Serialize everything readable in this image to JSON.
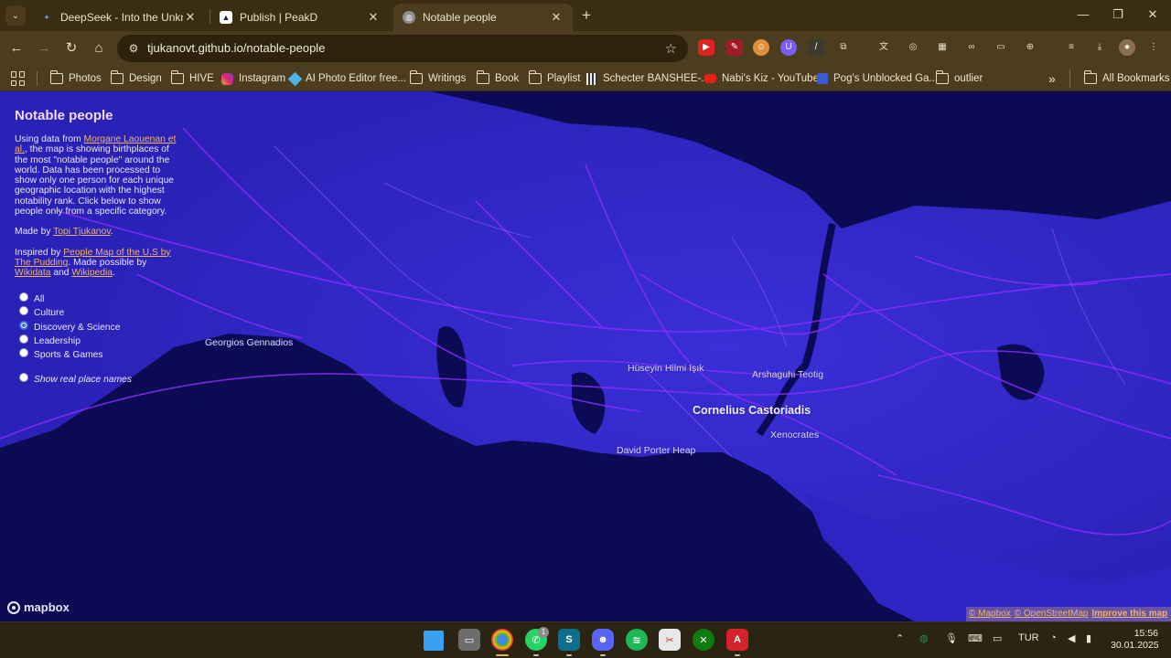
{
  "browser": {
    "tabs": [
      {
        "title": "DeepSeek - Into the Unknown",
        "active": false
      },
      {
        "title": "Publish | PeakD",
        "active": false
      },
      {
        "title": "Notable people",
        "active": true
      }
    ],
    "url": "tjukanovt.github.io/notable-people",
    "bookmarks": [
      {
        "label": "Photos",
        "icon": "folder-icon"
      },
      {
        "label": "Design",
        "icon": "folder-icon"
      },
      {
        "label": "HIVE",
        "icon": "folder-icon"
      },
      {
        "label": "Instagram",
        "icon": "instagram-icon"
      },
      {
        "label": "AI Photo Editor free...",
        "icon": "ai-editor-icon"
      },
      {
        "label": "Writings",
        "icon": "folder-icon"
      },
      {
        "label": "Book",
        "icon": "folder-icon"
      },
      {
        "label": "Playlist",
        "icon": "folder-icon"
      },
      {
        "label": "Schecter BANSHEE-...",
        "icon": "schecter-icon"
      },
      {
        "label": "Nabi's Kiz - YouTube",
        "icon": "youtube-icon"
      },
      {
        "label": "Pog's Unblocked Ga...",
        "icon": "game-icon"
      },
      {
        "label": "outlier",
        "icon": "folder-icon"
      }
    ],
    "bookmarks_overflow": "»",
    "all_bookmarks": "All Bookmarks"
  },
  "panel": {
    "title": "Notable people",
    "intro_pre": "Using data from ",
    "intro_link": "Morgane Laouenan et al.",
    "intro_post": ", the map is showing birthplaces of the most \"notable people\" around the world. Data has been processed to show only one person for each unique geographic location with the highest notability rank. Click below to show people only from a specific category.",
    "made_by_pre": "Made by ",
    "made_by_link": "Topi Tjukanov",
    "made_by_post": ".",
    "inspired_pre": "Inspired by ",
    "inspired_link": "People Map of the U.S by The Pudding",
    "inspired_mid": ". Made possible by ",
    "wikidata_link": "Wikidata",
    "and_text": " and ",
    "wikipedia_link": "Wikipedia",
    "end_text": ".",
    "categories": [
      "All",
      "Culture",
      "Discovery & Science",
      "Leadership",
      "Sports & Games"
    ],
    "selected_category": "Discovery & Science",
    "place_names_toggle": "Show real place names"
  },
  "map": {
    "labels": [
      {
        "name": "Georgios Gennadios",
        "major": false
      },
      {
        "name": "Hüseyin Hilmi Işık",
        "major": false
      },
      {
        "name": "Arshaguhi Teotig",
        "major": false
      },
      {
        "name": "Cornelius Castoriadis",
        "major": true
      },
      {
        "name": "Xenocrates",
        "major": false
      },
      {
        "name": "David Porter Heap",
        "major": false
      }
    ],
    "logo": "mapbox",
    "attribution": [
      "© Mapbox",
      "© OpenStreetMap",
      "Improve this map"
    ],
    "colors": {
      "sea": "#0b0a52",
      "land": "#2e24c4",
      "roads": "#8a2bff"
    }
  },
  "taskbar": {
    "language": "TUR",
    "time": "15:56",
    "date": "30.01.2025",
    "whatsapp_badge": "1"
  }
}
